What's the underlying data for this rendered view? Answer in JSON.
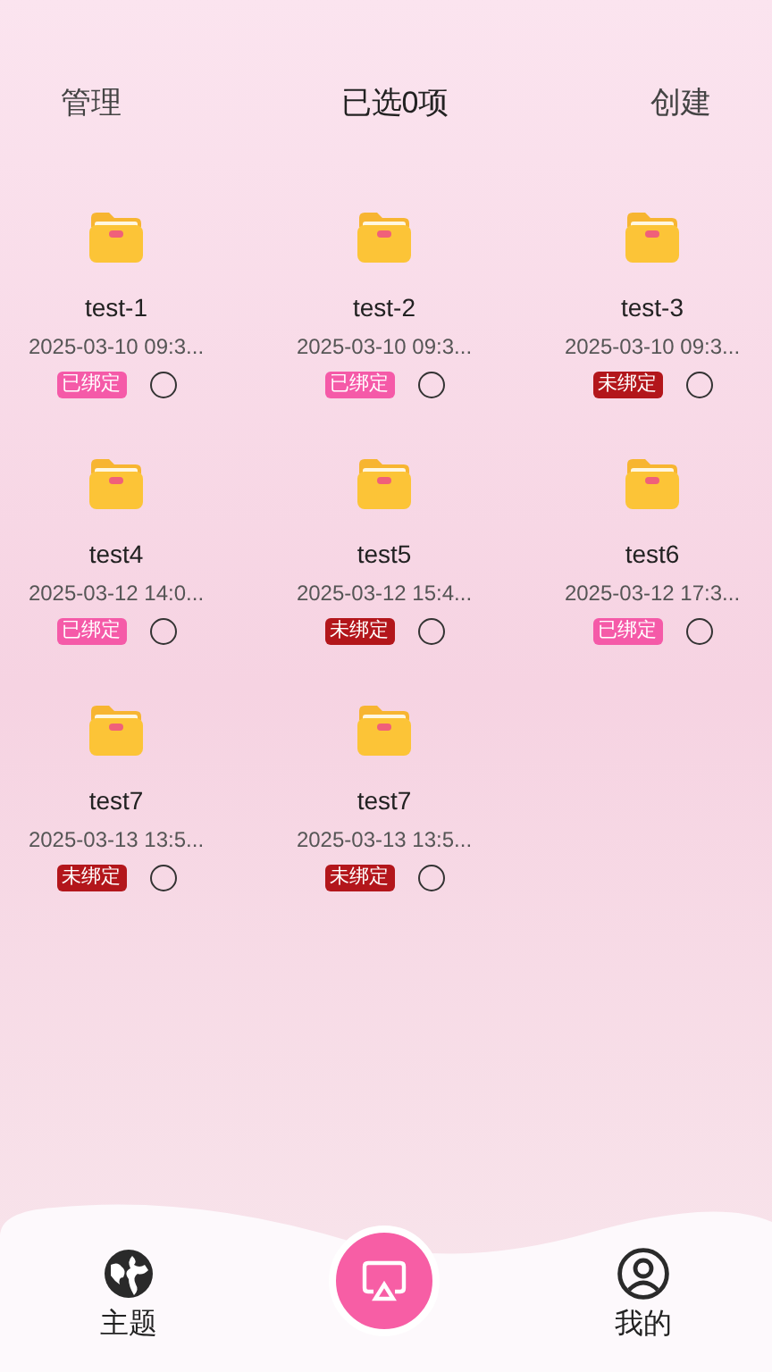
{
  "header": {
    "left": "管理",
    "title": "已选0项",
    "right": "创建"
  },
  "items": [
    {
      "name": "test-1",
      "date": "2025-03-10 09:3...",
      "badge": "已绑定",
      "bound": true,
      "selected": false
    },
    {
      "name": "test-2",
      "date": "2025-03-10 09:3...",
      "badge": "已绑定",
      "bound": true,
      "selected": false
    },
    {
      "name": "test-3",
      "date": "2025-03-10 09:3...",
      "badge": "未绑定",
      "bound": false,
      "selected": false
    },
    {
      "name": "test4",
      "date": "2025-03-12 14:0...",
      "badge": "已绑定",
      "bound": true,
      "selected": false
    },
    {
      "name": "test5",
      "date": "2025-03-12 15:4...",
      "badge": "未绑定",
      "bound": false,
      "selected": false
    },
    {
      "name": "test6",
      "date": "2025-03-12 17:3...",
      "badge": "已绑定",
      "bound": true,
      "selected": false
    },
    {
      "name": "test7",
      "date": "2025-03-13 13:5...",
      "badge": "未绑定",
      "bound": false,
      "selected": false
    },
    {
      "name": "test7",
      "date": "2025-03-13 13:5...",
      "badge": "未绑定",
      "bound": false,
      "selected": false
    }
  ],
  "nav": [
    {
      "label": "主题"
    },
    {
      "label": "我的"
    }
  ]
}
